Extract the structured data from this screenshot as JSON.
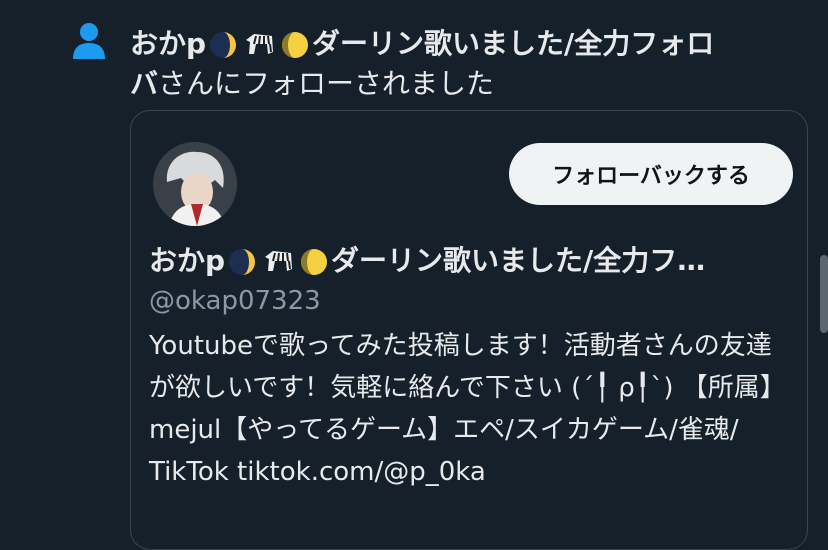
{
  "notification": {
    "icon": "person-icon",
    "name_part1": "おかp",
    "name_part2": "ダーリン歌いました/全力フォロ",
    "name_part3": "バ",
    "action_text": "さんにフォローされました"
  },
  "card": {
    "follow_back_label": "フォローバックする",
    "name_part1": "おかp",
    "name_part2": "ダーリン歌いました/全力フ…",
    "handle": "@okap07323",
    "bio": "Youtubeで歌ってみた投稿します！活動者さんの友達が欲しいです！気軽に絡んで下さい (´╿ ρ╿`) 【所属】mejul【やってるゲーム】エペ/スイカゲーム/雀魂/ TikTok tiktok.com/@p_0ka"
  },
  "colors": {
    "background": "#15202b",
    "accent_blue": "#1d9bf0",
    "button_bg": "#eff3f4"
  }
}
